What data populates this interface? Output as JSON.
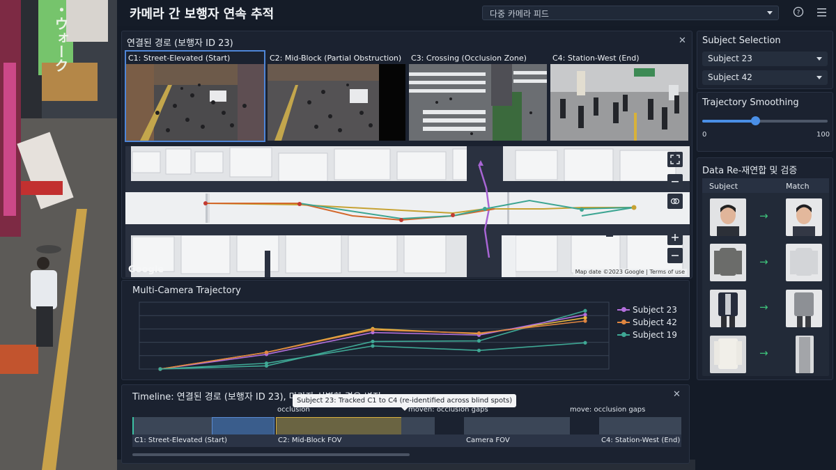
{
  "app": {
    "title": "카메라 간 보행자 연속 추적",
    "feed_select": "다중 카메라 피드"
  },
  "bg_sign": {
    "text": "・ウォーク"
  },
  "path_panel": {
    "title": "연결된 경로 (보행자 ID 23)",
    "cameras": [
      {
        "label": "C1: Street-Elevated (Start)"
      },
      {
        "label": "C2: Mid-Block (Partial Obstruction)"
      },
      {
        "label": "C3: Crossing (Occlusion Zone)"
      },
      {
        "label": "C4: Station-West (End)"
      }
    ]
  },
  "map": {
    "brand": "Google",
    "attribution": "Map date ©2023 Google | Terms of use"
  },
  "trajectory": {
    "title": "Multi-Camera Trajectory",
    "chart_data": {
      "type": "line",
      "x": [
        0,
        1,
        2,
        3,
        4
      ],
      "series": [
        {
          "name": "Subject 23",
          "color": "#b36fdc",
          "values": [
            0,
            0.23,
            0.57,
            0.53,
            0.85
          ]
        },
        {
          "name": "Subject 42",
          "color": "#e08640",
          "values": [
            0,
            0.26,
            0.61,
            0.56,
            0.75
          ]
        },
        {
          "name": "Subject 19",
          "color": "#3fa895",
          "values": [
            0,
            0.09,
            0.36,
            0.29,
            0.41
          ]
        }
      ],
      "yellow_color": "#e8b840",
      "yellow_values": [
        0,
        0.26,
        0.63,
        0.55,
        0.8
      ],
      "lower_line": [
        0,
        0.05,
        0.43,
        0.44,
        0.91
      ],
      "grid": true
    }
  },
  "subject_selection": {
    "title": "Subject Selection",
    "options": [
      "Subject 23",
      "Subject 42"
    ]
  },
  "smoothing": {
    "title": "Trajectory Smoothing",
    "min": "0",
    "max": "100",
    "value": 0.42
  },
  "reid": {
    "title": "Data Re-재연합 및 검증",
    "col_subject": "Subject",
    "col_match": "Match",
    "rows": [
      {
        "arrow": "→"
      },
      {
        "arrow": "→"
      },
      {
        "arrow": "→"
      },
      {
        "arrow": "→"
      }
    ]
  },
  "timeline": {
    "title": "Timeline: 연결된 경로 (보행자 ID 23), 마라자 식별한 경유 변적",
    "tooltip": "Subject 23: Tracked C1 to C4 (re-identified across blind spots)",
    "events": [
      "occlusion",
      "moven: occlusion gaps",
      "move: occlusion gaps"
    ],
    "segments": [
      "C1: Street-Elevated (Start)",
      "C2: Mid-Block FOV",
      "Camera FOV",
      "C4: Station-West (End)"
    ]
  }
}
